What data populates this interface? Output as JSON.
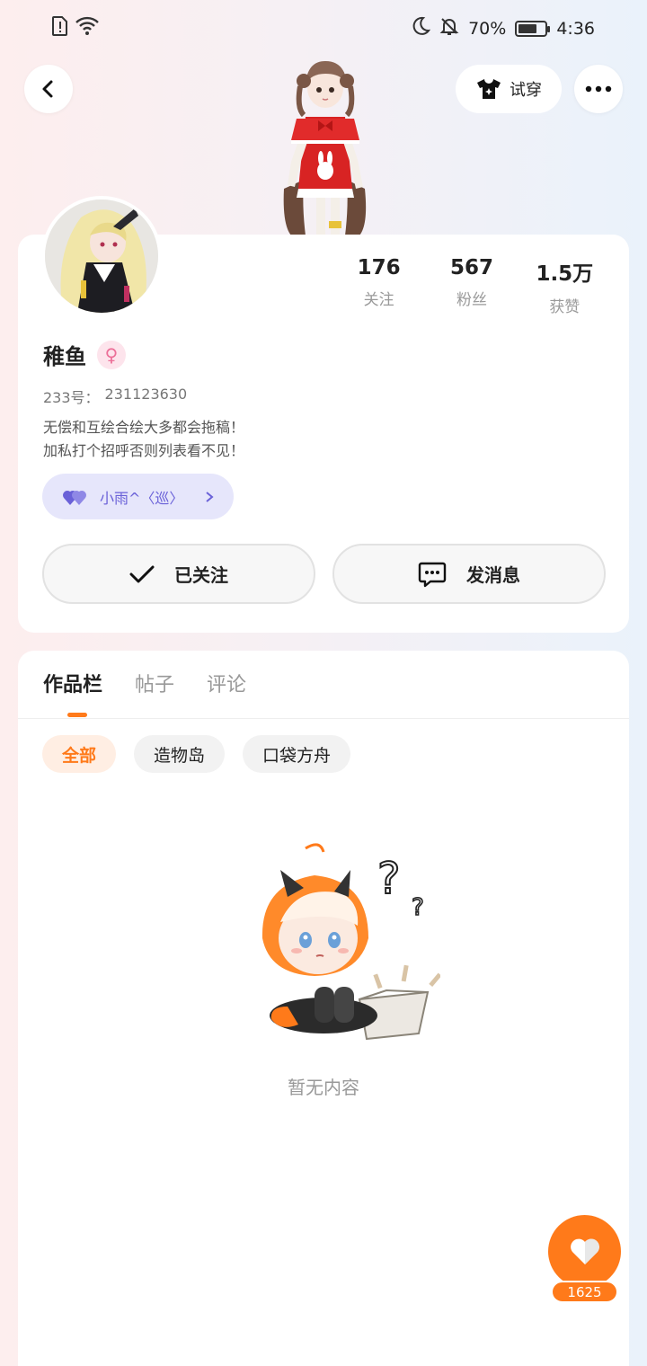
{
  "status_bar": {
    "battery": "70%",
    "battery_level": 0.7,
    "time": "4:36",
    "icons": [
      "sim-alert-icon",
      "wifi-icon",
      "moon-icon",
      "bell-off-icon",
      "battery-icon"
    ]
  },
  "header": {
    "try_on_label": "试穿"
  },
  "profile": {
    "name": "稚鱼",
    "uid_label": "233号：",
    "uid_value": "231123630",
    "bio_line1": "无偿和互绘合绘大多都会拖稿！",
    "bio_line2": "加私打个招呼否则列表看不见！",
    "medal_label": "小雨^〈巡〉",
    "stats": [
      {
        "value": "176",
        "label": "关注"
      },
      {
        "value": "567",
        "label": "粉丝"
      },
      {
        "value": "1.5万",
        "label": "获赞"
      }
    ],
    "follow_label": "已关注",
    "message_label": "发消息"
  },
  "content": {
    "tabs": [
      "作品栏",
      "帖子",
      "评论"
    ],
    "chips": [
      "全部",
      "造物岛",
      "口袋方舟"
    ],
    "empty_text": "暂无内容"
  },
  "like": {
    "count": "1625"
  },
  "colors": {
    "accent": "#ff7a1a",
    "medal_bg": "#e6e6fb",
    "medal_text": "#6a61d8",
    "gender_female": "#ec6f98"
  }
}
